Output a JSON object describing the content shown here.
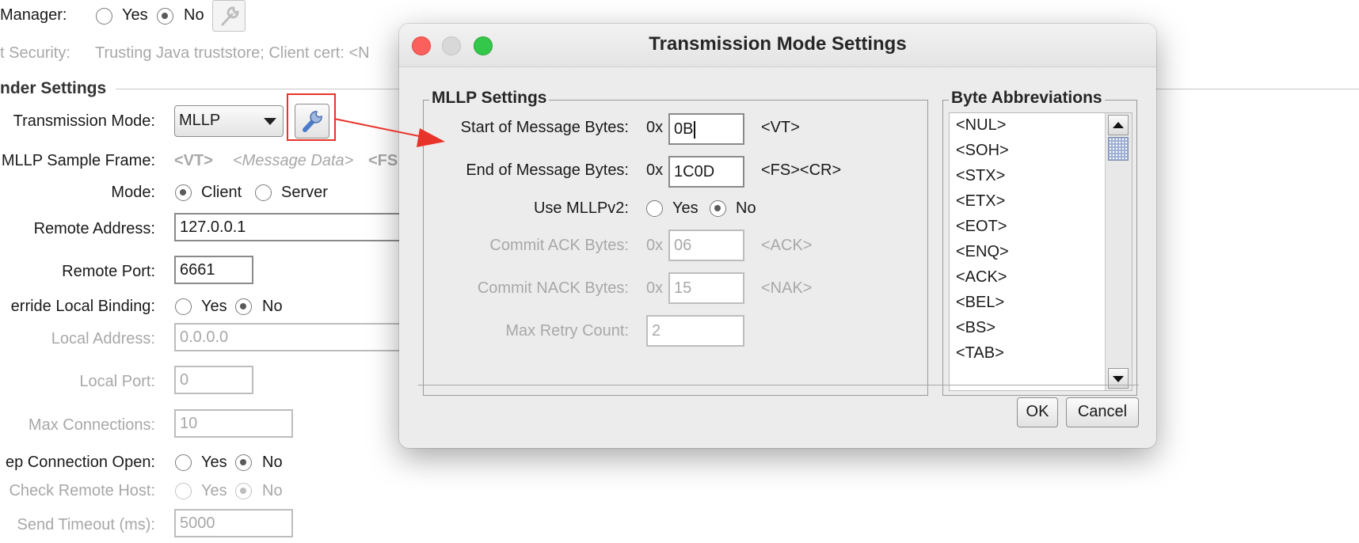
{
  "background": {
    "manager_label": "Manager:",
    "yes": "Yes",
    "no": "No",
    "security_label": "t Security:",
    "security_value": "Trusting Java truststore; Client cert: <N",
    "sender_settings_title": "nder Settings",
    "transmission_mode_label": "Transmission Mode:",
    "transmission_mode_value": "MLLP",
    "sample_frame_label": "MLLP Sample Frame:",
    "sample_frame_vt": "<VT>",
    "sample_frame_data": "<Message Data>",
    "sample_frame_fs": "<FS",
    "mode_label": "Mode:",
    "mode_client": "Client",
    "mode_server": "Server",
    "remote_address_label": "Remote Address:",
    "remote_address_value": "127.0.0.1",
    "remote_port_label": "Remote Port:",
    "remote_port_value": "6661",
    "override_binding_label": "erride Local Binding:",
    "local_address_label": "Local Address:",
    "local_address_value": "0.0.0.0",
    "local_port_label": "Local Port:",
    "local_port_value": "0",
    "max_connections_label": "Max Connections:",
    "max_connections_value": "10",
    "keep_open_label": "ep Connection Open:",
    "check_remote_label": "Check Remote Host:",
    "send_timeout_label": "Send Timeout (ms):",
    "send_timeout_value": "5000"
  },
  "dialog": {
    "title": "Transmission Mode Settings",
    "mllp_group_title": "MLLP Settings",
    "start_label": "Start of Message Bytes:",
    "start_prefix": "0x",
    "start_value": "0B",
    "start_abbr": "<VT>",
    "end_label": "End of Message Bytes:",
    "end_prefix": "0x",
    "end_value": "1C0D",
    "end_abbr": "<FS><CR>",
    "mllpv2_label": "Use MLLPv2:",
    "yes": "Yes",
    "no": "No",
    "commit_ack_label": "Commit ACK Bytes:",
    "commit_ack_prefix": "0x",
    "commit_ack_value": "06",
    "commit_ack_abbr": "<ACK>",
    "commit_nack_label": "Commit NACK Bytes:",
    "commit_nack_prefix": "0x",
    "commit_nack_value": "15",
    "commit_nack_abbr": "<NAK>",
    "max_retry_label": "Max Retry Count:",
    "max_retry_value": "2",
    "byte_group_title": "Byte Abbreviations",
    "byte_list": [
      "<NUL>",
      "<SOH>",
      "<STX>",
      "<ETX>",
      "<EOT>",
      "<ENQ>",
      "<ACK>",
      "<BEL>",
      "<BS>",
      "<TAB>"
    ],
    "ok_label": "OK",
    "cancel_label": "Cancel"
  },
  "colors": {
    "annotation_red": "#e8332a",
    "close_button": "#fc605c",
    "maximize_button": "#34c84a"
  }
}
